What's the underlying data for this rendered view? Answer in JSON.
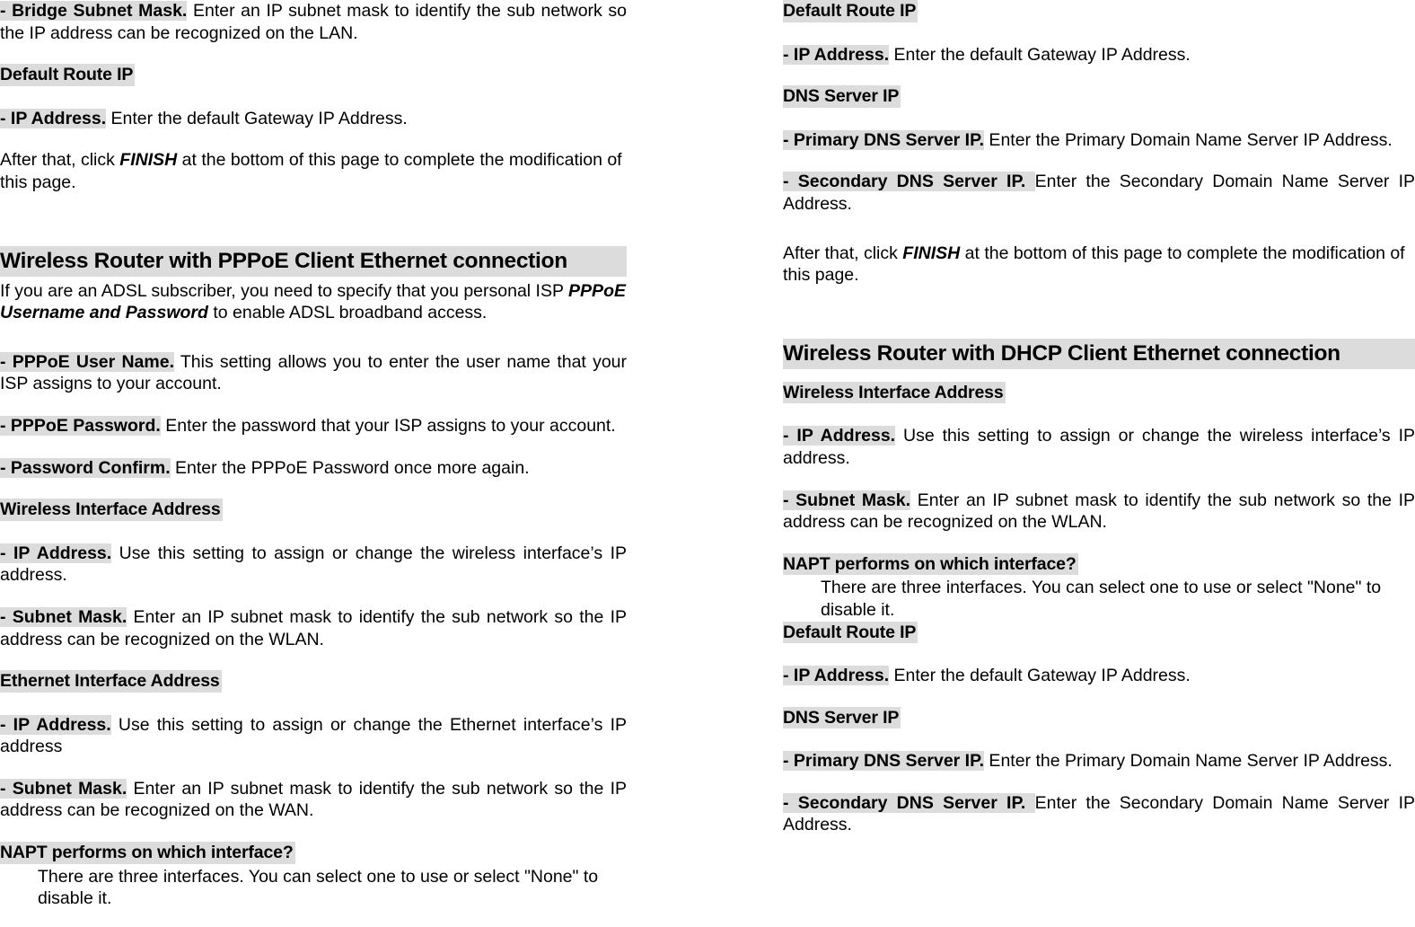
{
  "document": {
    "type": "wireless-router-configuration-manual-page",
    "columns": 2
  },
  "left_column": {
    "blocks": [
      {
        "id": "bridge-subnet-mask",
        "lead": "- Bridge Subnet Mask.",
        "body": " Enter an IP subnet mask to identify the sub network so the IP address can be recognized on the LAN."
      },
      {
        "id": "default-route-ip-heading",
        "heading": "Default Route IP"
      },
      {
        "id": "default-route-ip-address",
        "lead": "- IP Address.",
        "body": " Enter the default Gateway IP Address."
      },
      {
        "id": "finish-note-1",
        "before": "After that, click ",
        "emphasis": "FINISH",
        "after": " at the bottom of this page to complete the modification of this page."
      },
      {
        "id": "pppoe-section-title",
        "heading": "Wireless Router with PPPoE Client Ethernet connection"
      },
      {
        "id": "adsl-intro",
        "before": "If you are an ADSL subscriber, you need to specify that you personal ISP ",
        "emphasis": "PPPoE Username and Password",
        "after": " to enable ADSL broadband access."
      },
      {
        "id": "pppoe-user-name",
        "lead": "- PPPoE User Name.",
        "body": " This setting allows you to enter the user name that your ISP assigns to your account."
      },
      {
        "id": "pppoe-password",
        "lead": "- PPPoE Password.",
        "body": " Enter the password that your ISP assigns to your account."
      },
      {
        "id": "password-confirm",
        "lead": "- Password Confirm.",
        "body": " Enter the PPPoE Password once more again."
      },
      {
        "id": "wireless-interface-address-heading",
        "heading": "Wireless Interface Address"
      },
      {
        "id": "wireless-ip-address",
        "lead": "- IP Address.",
        "body": " Use this setting to assign or change the wireless interface’s IP address."
      },
      {
        "id": "wireless-subnet-mask",
        "lead": "- Subnet Mask.",
        "body": " Enter an IP subnet mask to identify the sub network so the IP address can be recognized on the WLAN."
      },
      {
        "id": "ethernet-interface-address-heading",
        "heading": "Ethernet Interface Address"
      },
      {
        "id": "ethernet-ip-address",
        "lead": "- IP Address.",
        "body": " Use this setting to assign or change the Ethernet interface’s IP address"
      },
      {
        "id": "ethernet-subnet-mask",
        "lead": "- Subnet Mask.",
        "body": " Enter an IP subnet mask to identify the sub network so the IP address can be recognized on the WAN."
      },
      {
        "id": "napt-heading",
        "heading": "NAPT performs on which interface?"
      },
      {
        "id": "napt-body",
        "body": "There are three interfaces. You can select one to use or select \"None\" to disable it."
      }
    ]
  },
  "right_column": {
    "blocks": [
      {
        "id": "default-route-ip-heading-1",
        "heading": "Default Route IP"
      },
      {
        "id": "default-route-ip-address-1",
        "lead": "- IP Address.",
        "body": " Enter the default Gateway IP Address."
      },
      {
        "id": "dns-server-ip-heading-1",
        "heading": "DNS Server IP"
      },
      {
        "id": "primary-dns-1",
        "lead": "- Primary DNS Server IP.",
        "body": " Enter the Primary Domain Name Server IP Address."
      },
      {
        "id": "secondary-dns-1",
        "lead": "- Secondary DNS Server IP. ",
        "body": " Enter the Secondary Domain Name Server IP Address."
      },
      {
        "id": "finish-note-2",
        "before": "After that, click ",
        "emphasis": "FINISH",
        "after": " at the bottom of this page to complete the modification of this page."
      },
      {
        "id": "dhcp-section-title",
        "heading": "Wireless Router with DHCP Client Ethernet connection"
      },
      {
        "id": "wireless-interface-address-heading-2",
        "heading": "Wireless Interface Address"
      },
      {
        "id": "wireless-ip-address-2",
        "lead": "- IP Address.",
        "body": " Use this setting to assign or change the wireless interface’s IP address."
      },
      {
        "id": "wireless-subnet-mask-2",
        "lead": "- Subnet Mask.",
        "body": " Enter an IP subnet mask to identify the sub network so the IP address can be recognized on the WLAN."
      },
      {
        "id": "napt-heading-2",
        "heading": "NAPT performs on which interface?"
      },
      {
        "id": "napt-body-2",
        "body": "There are three interfaces. You can select one to use or select \"None\" to disable it."
      },
      {
        "id": "default-route-ip-heading-2",
        "heading": "Default Route IP"
      },
      {
        "id": "default-route-ip-address-2",
        "lead": "- IP Address.",
        "body": " Enter the default Gateway IP Address."
      },
      {
        "id": "dns-server-ip-heading-2",
        "heading": "DNS Server IP"
      },
      {
        "id": "primary-dns-2",
        "lead": "- Primary DNS Server IP.",
        "body": " Enter the Primary Domain Name Server IP Address."
      },
      {
        "id": "secondary-dns-2",
        "lead": "- Secondary DNS Server IP. ",
        "body": " Enter the Secondary Domain Name Server IP Address."
      }
    ]
  },
  "style": {
    "highlight_color": "#dcdcdc",
    "text_color": "#000000",
    "background_color": "#ffffff"
  }
}
